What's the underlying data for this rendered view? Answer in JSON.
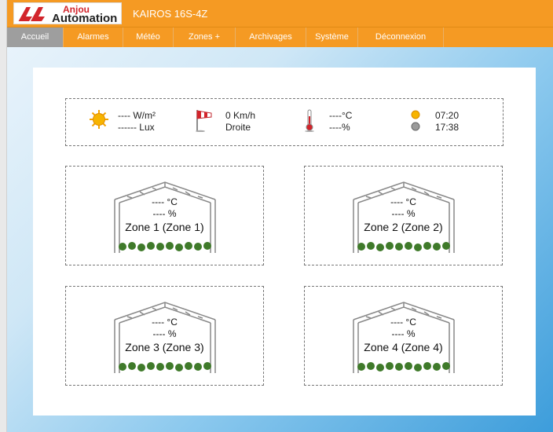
{
  "header": {
    "logo_line1": "Anjou",
    "logo_line2": "Automation",
    "app_title": "KAIROS 16S-4Z"
  },
  "nav": {
    "items": [
      {
        "label": "Accueil",
        "active": true
      },
      {
        "label": "Alarmes",
        "active": false
      },
      {
        "label": "Météo",
        "active": false
      },
      {
        "label": "Zones +",
        "active": false
      },
      {
        "label": "Archivages",
        "active": false
      },
      {
        "label": "Système",
        "active": false
      },
      {
        "label": "Déconnexion",
        "active": false
      }
    ]
  },
  "weather": {
    "radiation": "---- W/m²",
    "luminosity": "------ Lux",
    "wind_speed": "0 Km/h",
    "wind_direction": "Droite",
    "temperature": "----°C",
    "humidity": "----%",
    "sunrise": "07:20",
    "sunset": "17:38"
  },
  "zones": [
    {
      "temp": "---- °C",
      "hum": "---- %",
      "name": "Zone 1 (Zone 1)"
    },
    {
      "temp": "---- °C",
      "hum": "---- %",
      "name": "Zone 2 (Zone 2)"
    },
    {
      "temp": "---- °C",
      "hum": "---- %",
      "name": "Zone 3 (Zone 3)"
    },
    {
      "temp": "---- °C",
      "hum": "---- %",
      "name": "Zone 4 (Zone 4)"
    }
  ],
  "colors": {
    "header_orange": "#f59a23",
    "nav_active": "#9e9e9e",
    "brand_red": "#d2242b"
  }
}
